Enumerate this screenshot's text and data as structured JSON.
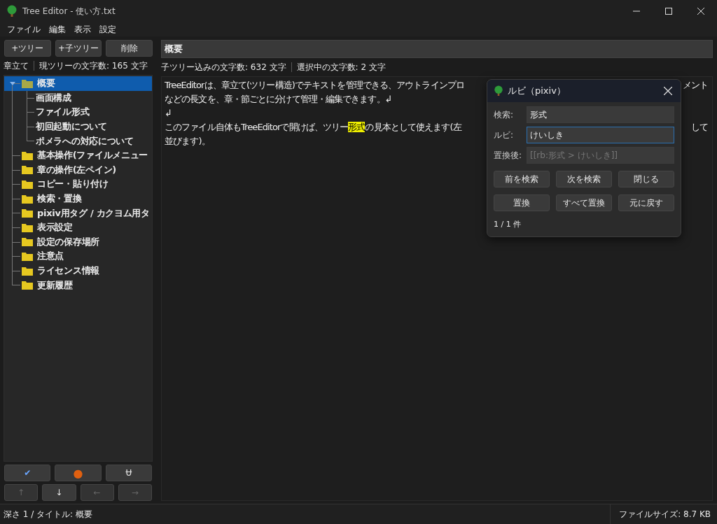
{
  "window": {
    "title": "Tree Editor - 使い方.txt"
  },
  "menu": [
    "ファイル",
    "編集",
    "表示",
    "設定"
  ],
  "toolbar": [
    "+ツリー",
    "+子ツリー",
    "削除"
  ],
  "title_field": {
    "value": "概要"
  },
  "info": {
    "mode": "章立て",
    "current_count": "現ツリーの文字数: 165 文字",
    "subtree_count": "子ツリー込みの文字数: 632 文字",
    "selection_count": "選択中の文字数: 2 文字"
  },
  "tree": [
    {
      "label": "概要",
      "selected": true,
      "expanded": true,
      "children": [
        {
          "label": "画面構成",
          "selected": false
        },
        {
          "label": "ファイル形式",
          "selected": false
        },
        {
          "label": "初回起動について",
          "selected": false
        },
        {
          "label": "ポメラへの対応について",
          "selected": false
        }
      ]
    },
    {
      "label": "基本操作(ファイルメニュー",
      "selected": false
    },
    {
      "label": "章の操作(左ペイン)",
      "selected": false
    },
    {
      "label": "コピー・貼り付け",
      "selected": false
    },
    {
      "label": "検索・置換",
      "selected": false
    },
    {
      "label": "pixiv用タグ / カクヨム用タ",
      "selected": false
    },
    {
      "label": "表示設定",
      "selected": false
    },
    {
      "label": "設定の保存場所",
      "selected": false
    },
    {
      "label": "注意点",
      "selected": false
    },
    {
      "label": "ライセンス情報",
      "selected": false
    },
    {
      "label": "更新履歴",
      "selected": false
    }
  ],
  "mark_buttons": [
    {
      "label": "✔",
      "kind": "check"
    },
    {
      "label": "●",
      "kind": "dot"
    },
    {
      "label": "Ʉ",
      "kind": "strike"
    }
  ],
  "move_buttons": [
    {
      "label": "↑",
      "disabled": true
    },
    {
      "label": "↓",
      "disabled": false
    },
    {
      "label": "←",
      "disabled": true
    },
    {
      "label": "→",
      "disabled": true
    }
  ],
  "editor_lines": [
    {
      "left": [
        {
          "text": "TreeEditorは、章立て(ツリー構造)でテキストを管理できる、アウトラインプロ",
          "highlight": false
        }
      ],
      "right": "メント"
    },
    {
      "left": [
        {
          "text": "などの長文を、章・節ごとに分けて管理・編集できます。↲",
          "highlight": false
        }
      ]
    },
    {
      "left": [
        {
          "text": "↲",
          "highlight": false
        }
      ]
    },
    {
      "left": [
        {
          "text": "このファイル自体もTreeEditorで開けば、ツリー",
          "highlight": false
        },
        {
          "text": "形式",
          "highlight": true
        },
        {
          "text": "の見本として使えます(左",
          "highlight": false
        }
      ],
      "right": "して"
    },
    {
      "left": [
        {
          "text": "並びます)。",
          "highlight": false
        }
      ]
    }
  ],
  "dialog": {
    "title": "ルビ（pixiv）",
    "fields": [
      {
        "label": "検索:",
        "value": "形式",
        "focused": false,
        "kind": "input"
      },
      {
        "label": "ルビ:",
        "value": "けいしき",
        "focused": true,
        "kind": "input"
      },
      {
        "label": "置換後:",
        "placeholder": "[[rb:形式 > けいしき]]",
        "focused": false,
        "kind": "preview"
      }
    ],
    "buttons": [
      [
        "前を検索",
        "次を検索",
        "閉じる"
      ],
      [
        "置換",
        "すべて置換",
        "元に戻す"
      ]
    ],
    "result": "1 / 1 件"
  },
  "status_bar": {
    "left": "深さ 1 / タイトル: 概要",
    "right": "ファイルサイズ: 8.7 KB"
  }
}
